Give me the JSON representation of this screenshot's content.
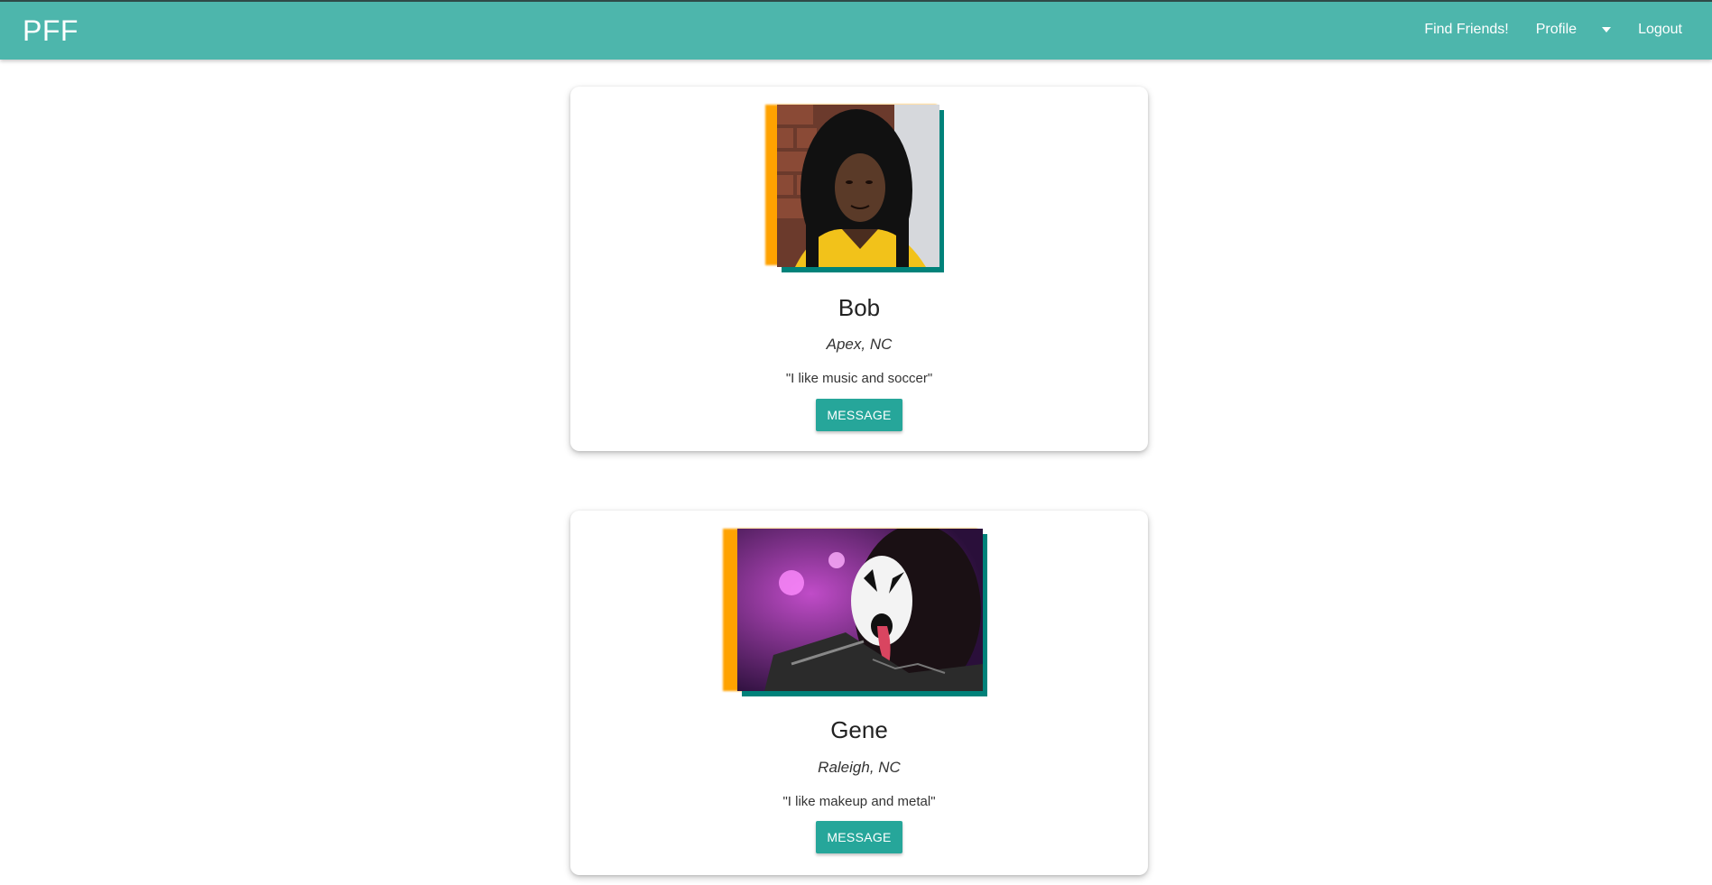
{
  "navbar": {
    "brand": "PFF",
    "links": {
      "find_friends": "Find Friends!",
      "profile": "Profile",
      "logout": "Logout"
    }
  },
  "cards": [
    {
      "name": "Bob",
      "location": "Apex, NC",
      "bio": "\"I like music and soccer\"",
      "button": "MESSAGE"
    },
    {
      "name": "Gene",
      "location": "Raleigh, NC",
      "bio": "\"I like makeup and metal\"",
      "button": "MESSAGE"
    }
  ],
  "colors": {
    "navbar": "#4db6ac",
    "button": "#26a69a",
    "photo_accent_orange": "#ffa200",
    "photo_accent_teal": "#00827a"
  }
}
